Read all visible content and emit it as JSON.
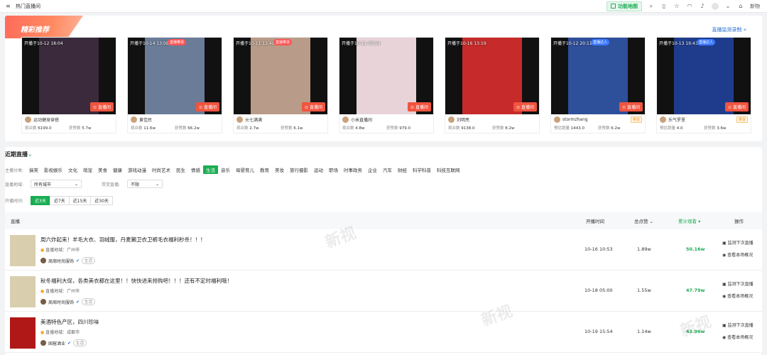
{
  "topbar": {
    "breadcrumb": "热门直播间",
    "func_button": "功能地图",
    "newbie": "新物"
  },
  "recommend": {
    "title": "精彩推荐",
    "monitor_link": "直播监测录制 »",
    "enter_label": "直播间",
    "cards": [
      {
        "start": "开播于10-12 18:04",
        "badge": "",
        "host": "运动健身穿搭",
        "stat1_label": "观众数",
        "stat1": "6199.0",
        "stat2_label": "获赞数",
        "stat2": "5.7w",
        "tag": "",
        "pic_color": "#3a2a3c",
        "badge_color": "red"
      },
      {
        "start": "开播于10-14 13:08",
        "badge": "直播带货",
        "host": "黄佳民",
        "stat1_label": "观众数",
        "stat1": "11.6w",
        "stat2_label": "获赞数",
        "stat2": "66.2w",
        "tag": "",
        "pic_color": "#6a7c98",
        "badge_color": "red"
      },
      {
        "start": "开播于10-11 13:48",
        "badge": "直播带货",
        "host": "元七满满",
        "stat1_label": "观众数",
        "stat1": "2.7w",
        "stat2_label": "获赞数",
        "stat2": "6.1w",
        "tag": "",
        "pic_color": "#b89b88",
        "badge_color": "red"
      },
      {
        "start": "开播于10-11 09:54",
        "badge": "",
        "host": "小米直播间",
        "stat1_label": "观众数",
        "stat1": "4.8w",
        "stat2_label": "获赞数",
        "stat2": "979.0",
        "tag": "",
        "pic_color": "#e7d3d8",
        "badge_color": "red"
      },
      {
        "start": "开播于10-16 13:19",
        "badge": "",
        "host": "刘明亮",
        "stat1_label": "观众数",
        "stat1": "9138.0",
        "stat2_label": "获赞数",
        "stat2": "8.2w",
        "tag": "",
        "pic_color": "#c72a2a",
        "badge_color": "red"
      },
      {
        "start": "开播于10-12 20:11",
        "badge": "直播达人",
        "host": "stormzhang",
        "stat1_label": "预估销量",
        "stat1": "1443.0",
        "stat2_label": "获赞数",
        "stat2": "6.2w",
        "tag": "带货",
        "pic_color": "#2e4f9a",
        "badge_color": "blue"
      },
      {
        "start": "开播于10-13 19:43",
        "badge": "直播达人",
        "host": "乐气罗里",
        "stat1_label": "预估销量",
        "stat1": "4.0",
        "stat2_label": "获赞数",
        "stat2": "3.6w",
        "tag": "带货",
        "pic_color": "#1f3c8c",
        "badge_color": "blue"
      }
    ]
  },
  "recent": {
    "title": "近期直播",
    "category_label": "主播分类:",
    "categories": [
      "搞笑",
      "影视娱乐",
      "文化",
      "萌宠",
      "美食",
      "健康",
      "游戏动漫",
      "时尚艺术",
      "民生",
      "情感",
      "生活",
      "音乐",
      "母婴育儿",
      "教育",
      "美妆",
      "旅行摄影",
      "运动",
      "职场",
      "时事政务",
      "企业",
      "汽车",
      "财经",
      "科学科普",
      "科技互联网"
    ],
    "active_category": "生活",
    "region_label": "直播地域:",
    "region_value": "所有城市",
    "goods_label": "带货直播:",
    "goods_value": "不限",
    "time_label": "开播时间:",
    "days": [
      "近3天",
      "近7天",
      "近15天",
      "近30天"
    ],
    "active_day": "近3天"
  },
  "table": {
    "headers": {
      "live": "直播",
      "time": "开播时间",
      "pv": "总点赞",
      "sales": "累计观看",
      "op": "操作"
    },
    "op_monitor": "监测下次直播",
    "op_view": "查看本场概况",
    "rows": [
      {
        "title": "周六炸起来！羊毛大衣、羽绒服，丹麦獭卫衣卫裤毛衣福利秒杀！！！",
        "loc": "直播地域：广州市",
        "shop": "周周时尚服饰",
        "tag": "生活",
        "time": "10-16 10:53",
        "pv": "1.89w",
        "sales": "50.16w",
        "cover": "#d9cfae"
      },
      {
        "title": "秋冬福利大促，各类美衣都在这里！！快快进来抢购吧！！！还有不定时福利哦！",
        "loc": "直播地域：广州市",
        "shop": "周周时尚服饰",
        "tag": "生活",
        "time": "10-18 05:00",
        "pv": "1.55w",
        "sales": "47.79w",
        "cover": "#d9cfae"
      },
      {
        "title": "美酒特色产区，四川珍味",
        "loc": "直播地域：成都市",
        "shop": "国窖酒业",
        "tag": "生活",
        "time": "10-19 15:54",
        "pv": "1.14w",
        "sales": "43.96w",
        "cover": "#b01818"
      }
    ]
  }
}
